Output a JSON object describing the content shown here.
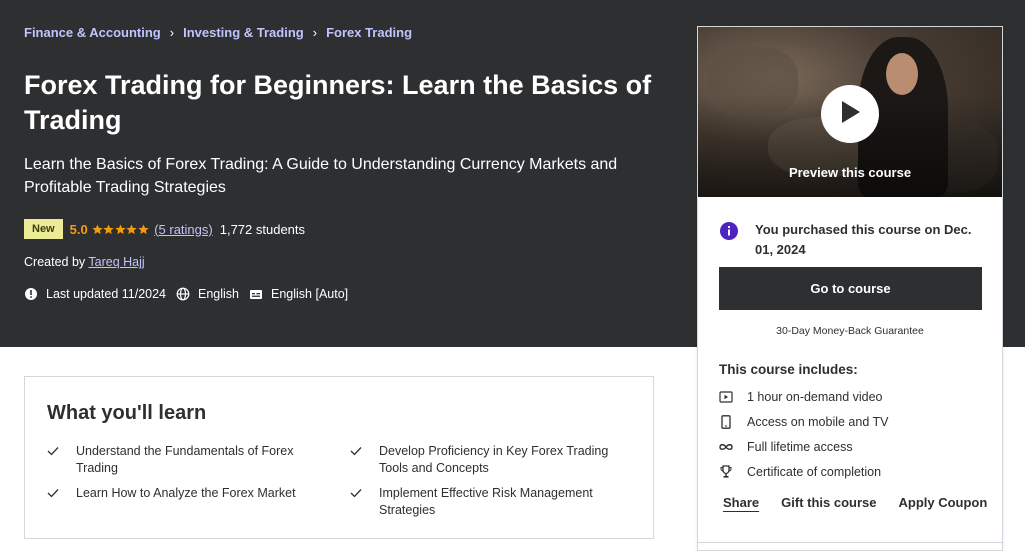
{
  "breadcrumbs": [
    "Finance & Accounting",
    "Investing & Trading",
    "Forex Trading"
  ],
  "course": {
    "title": "Forex Trading for Beginners: Learn the Basics of Trading",
    "subtitle": "Learn the Basics of Forex Trading: A Guide to Understanding Currency Markets and Profitable Trading Strategies",
    "badge": "New",
    "rating": "5.0",
    "star_count": 5,
    "ratings_link": "(5 ratings)",
    "students": "1,772 students",
    "created_by_label": "Created by",
    "instructor": "Tareq Hajj",
    "last_updated": "Last updated 11/2024",
    "language": "English",
    "captions": "English [Auto]"
  },
  "learn": {
    "title": "What you'll learn",
    "items": [
      "Understand the Fundamentals of Forex Trading",
      "Develop Proficiency in Key Forex Trading Tools and Concepts",
      "Learn How to Analyze the Forex Market",
      "Implement Effective Risk Management Strategies"
    ]
  },
  "sidebar": {
    "preview_label": "Preview this course",
    "purchased_text": "You purchased this course on Dec. 01, 2024",
    "go_button": "Go to course",
    "guarantee": "30-Day Money-Back Guarantee",
    "includes_title": "This course includes:",
    "includes": [
      {
        "icon": "video-icon",
        "label": "1 hour on-demand video"
      },
      {
        "icon": "mobile-icon",
        "label": "Access on mobile and TV"
      },
      {
        "icon": "infinity-icon",
        "label": "Full lifetime access"
      },
      {
        "icon": "trophy-icon",
        "label": "Certificate of completion"
      }
    ],
    "share": "Share",
    "gift": "Gift this course",
    "coupon": "Apply Coupon"
  },
  "colors": {
    "hero_bg": "#2d2f31",
    "link": "#c0c4fc",
    "star": "#f69c08",
    "badge_bg": "#eceb98",
    "info": "#5022c3"
  }
}
